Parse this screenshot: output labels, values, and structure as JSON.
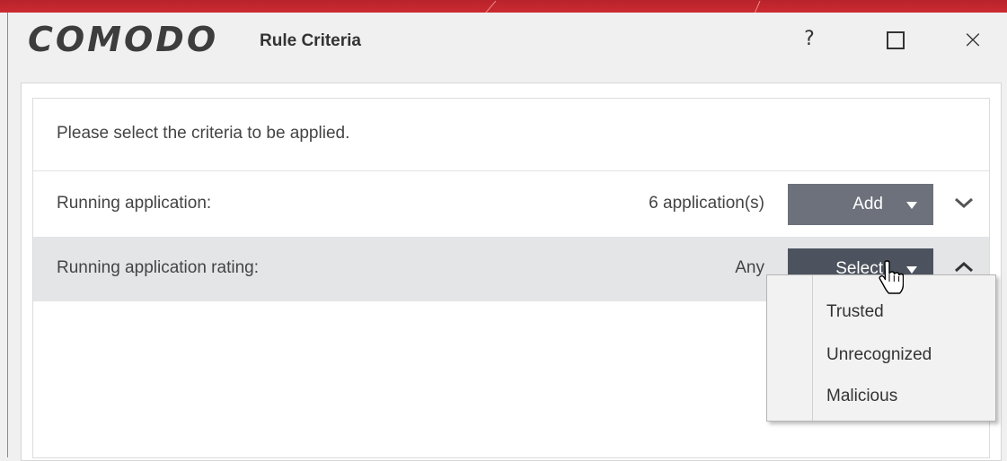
{
  "window": {
    "brand": "COMODO",
    "title": "Rule Criteria",
    "help_label": "?",
    "close_label": "×"
  },
  "instruction": "Please select the criteria to be applied.",
  "criteria": [
    {
      "label": "Running application:",
      "value": "6 application(s)",
      "button": "Add",
      "expanded": false
    },
    {
      "label": "Running application rating:",
      "value": "Any",
      "button": "Select",
      "expanded": true
    }
  ],
  "rating_menu": {
    "options": [
      "Trusted",
      "Unrecognized",
      "Malicious"
    ]
  },
  "colors": {
    "brand_bar": "#cc2a31",
    "add_button": "#6d717c",
    "select_button": "#4d535e",
    "selected_row": "#e4e5e7"
  },
  "icons": {
    "help": "question-icon",
    "maximize": "maximize-icon",
    "close": "close-icon",
    "collapse": "chevron-up-icon",
    "expand": "chevron-down-icon",
    "dropdown": "caret-down-icon",
    "cursor": "hand-pointer-icon"
  }
}
